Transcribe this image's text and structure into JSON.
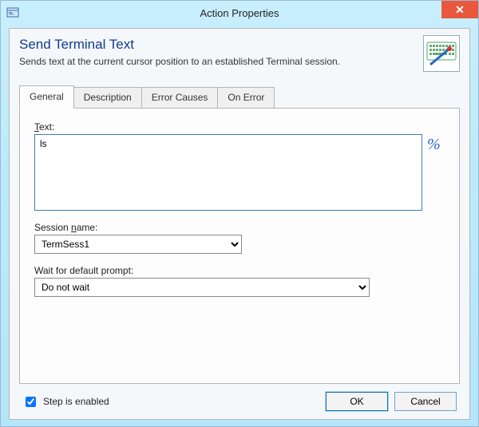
{
  "window": {
    "title": "Action Properties",
    "close_label": "✕"
  },
  "header": {
    "title": "Send Terminal Text",
    "subtitle": "Sends text at the current cursor position to an established Terminal session."
  },
  "tabs": [
    {
      "label": "General",
      "active": true
    },
    {
      "label": "Description",
      "active": false
    },
    {
      "label": "Error Causes",
      "active": false
    },
    {
      "label": "On Error",
      "active": false
    }
  ],
  "form": {
    "text_label_pre": "T",
    "text_label_post": "ext:",
    "text_value": "ls",
    "percent_icon_label": "%",
    "session_label_pre": "Session ",
    "session_label_ul": "n",
    "session_label_post": "ame:",
    "session_value": "TermSess1",
    "wait_label": "Wait for default prompt:",
    "wait_value": "Do not wait"
  },
  "footer": {
    "checkbox_label": "Step is enabled",
    "checkbox_checked": true,
    "ok_label": "OK",
    "cancel_label": "Cancel"
  }
}
